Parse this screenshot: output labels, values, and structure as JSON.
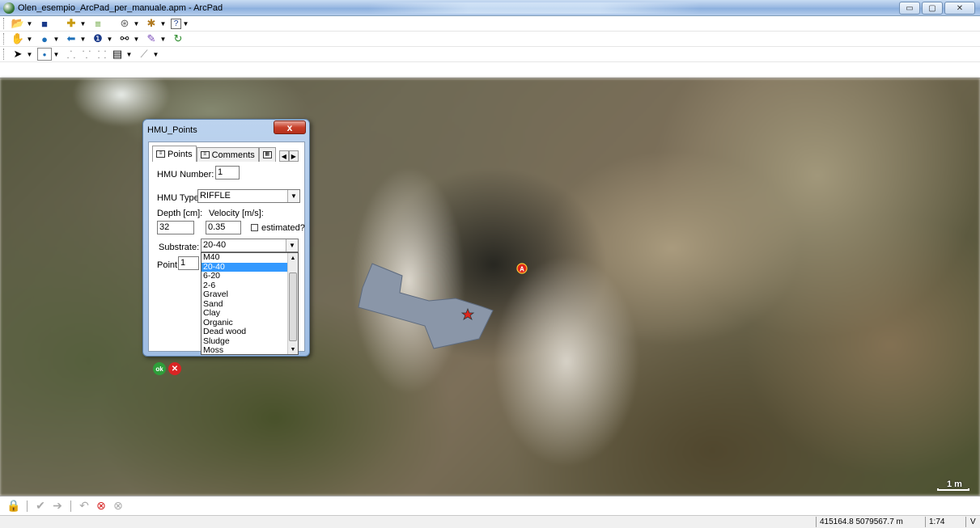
{
  "window": {
    "title": "Olen_esempio_ArcPad_per_manuale.apm - ArcPad",
    "minimize": "▭",
    "maximize": "▢",
    "close": "✕"
  },
  "toolbar_icons": {
    "row1": [
      "open-folder-icon",
      "save-icon",
      "add-layer-icon",
      "layers-icon",
      "gps-icon",
      "tools-icon",
      "help-icon"
    ],
    "row2": [
      "pan-hand-icon",
      "zoom-globe-icon",
      "back-arrow-icon",
      "identify-icon",
      "find-binoculars-icon",
      "edit-pen-icon",
      "refresh-icon"
    ],
    "row3": [
      "select-arrow-icon",
      "point-tool-icon",
      "vertex-icon",
      "vertex-add-icon",
      "vertex-move-icon",
      "attributes-form-icon",
      "line-tool-icon"
    ]
  },
  "dialog": {
    "title": "HMU_Points",
    "close_label": "x",
    "tabs": [
      {
        "label": "Points"
      },
      {
        "label": "Comments"
      }
    ],
    "hmu_number_label": "HMU Number:",
    "hmu_number_value": "1",
    "hmu_type_label": "HMU Type:",
    "hmu_type_value": "RIFFLE",
    "depth_label": "Depth [cm]:",
    "velocity_label": "Velocity [m/s]:",
    "depth_value": "32",
    "velocity_value": "0.35",
    "estimated_label": "estimated?",
    "substrate_label": "Substrate:",
    "substrate_value": "20-40",
    "point_label": "Point:",
    "point_value": "1",
    "substrate_options": [
      "M40",
      "20-40",
      "6-20",
      "2-6",
      "Gravel",
      "Sand",
      "Clay",
      "Organic",
      "Dead wood",
      "Sludge",
      "Moss"
    ],
    "selected_option": "20-40",
    "ok_label": "ok",
    "cancel_label": "✕"
  },
  "map": {
    "marker_label": "A",
    "scalebar_label": "1 m"
  },
  "bottom_toolbar_icons": [
    "lock-icon",
    "check-circle-icon",
    "forward-circle-icon",
    "undo-icon",
    "delete-red-icon",
    "cancel-circle-icon"
  ],
  "status": {
    "coordinates": "415164.8 5079567.7 m",
    "scale": "1:74",
    "extra": "V"
  },
  "colors": {
    "polygon_fill": "#8a96a8",
    "polygon_stroke": "#5d6a7e",
    "selection": "#3399ff",
    "marker_red": "#e0261a"
  }
}
